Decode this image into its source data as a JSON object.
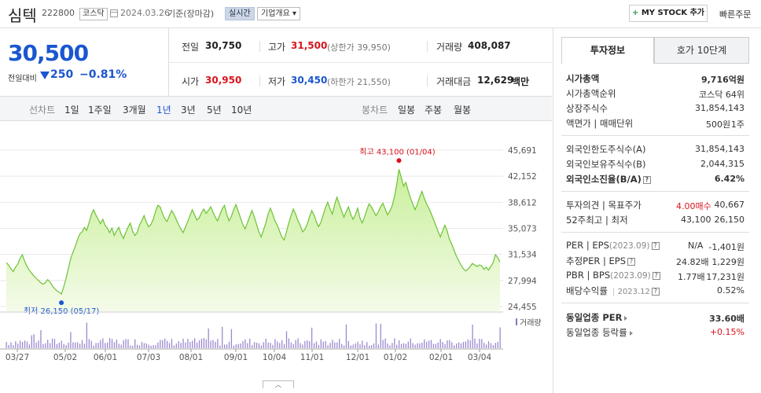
{
  "header": {
    "name": "심텍",
    "code": "222800",
    "market": "코스닥",
    "date": "2024.03.26",
    "basis": "기준(장마감)",
    "realtime": "실시간",
    "company_info": "기업개요",
    "company_info_arrow": "▾",
    "mystock_plus": "+",
    "mystock": "MY STOCK 추가",
    "quick_order": "빠른주문"
  },
  "price": {
    "current": "30,500",
    "diff_label": "전일대비",
    "diff": "250",
    "rate": "−0.81%",
    "prev_label": "전일",
    "prev": "30,750",
    "high_label": "고가",
    "high": "31,500",
    "upper_limit": "(상한가 39,950)",
    "volume_label": "거래량",
    "volume": "408,087",
    "open_label": "시가",
    "open": "30,950",
    "low_label": "저가",
    "low": "30,450",
    "lower_limit": "(하한가 21,550)",
    "amount_label": "거래대금",
    "amount": "12,629",
    "amount_unit": "백만"
  },
  "tabs": {
    "line_chart": "선차트",
    "periods": [
      "1일",
      "1주일",
      "3개월",
      "1년",
      "3년",
      "5년",
      "10년"
    ],
    "active_period": "1년",
    "candle_chart": "봉차트",
    "candle_periods": [
      "일봉",
      "주봉",
      "월봉"
    ]
  },
  "chart_data": {
    "type": "area",
    "y_ticks": [
      "45,691",
      "42,152",
      "38,612",
      "35,073",
      "31,534",
      "27,994",
      "24,455"
    ],
    "ylim": [
      24455,
      45691
    ],
    "x_ticks": [
      "03/27",
      "05/02",
      "06/01",
      "07/03",
      "08/01",
      "09/01",
      "10/04",
      "11/01",
      "12/01",
      "01/02",
      "02/01",
      "03/04"
    ],
    "high_annotation": "최고 43,100 (01/04)",
    "low_annotation": "최저 26,150 (05/17)",
    "high": 43100,
    "low": 26150,
    "volume_label": "거래량",
    "series": [
      {
        "values": [
          30400,
          30100,
          29600,
          29200,
          29800,
          30200,
          31000,
          31500,
          30600,
          29900,
          29400,
          29000,
          28600,
          28300,
          28000,
          27700,
          27500,
          27700,
          28100,
          27800,
          27300,
          26900,
          26600,
          26400,
          26150,
          27100,
          28200,
          29600,
          30900,
          31800,
          32600,
          33500,
          34300,
          34600,
          35200,
          34800,
          35800,
          36900,
          37600,
          36900,
          36300,
          35700,
          36300,
          35500,
          35100,
          34500,
          35100,
          34100,
          34700,
          35200,
          34300,
          33700,
          34500,
          35200,
          35800,
          34700,
          34100,
          34500,
          35500,
          36100,
          36800,
          35900,
          35300,
          35600,
          36300,
          37400,
          38200,
          38000,
          37100,
          36400,
          36000,
          36800,
          37500,
          37000,
          36300,
          35600,
          35000,
          34500,
          35200,
          36000,
          36800,
          37600,
          36900,
          36200,
          36500,
          37200,
          37700,
          37100,
          37500,
          38000,
          37300,
          36600,
          36100,
          36900,
          37700,
          38200,
          37000,
          36100,
          36700,
          37600,
          38300,
          37400,
          36500,
          35600,
          35000,
          35800,
          36700,
          37500,
          36600,
          35600,
          34600,
          33900,
          34800,
          35800,
          37000,
          37800,
          37000,
          36100,
          35500,
          34700,
          33900,
          33500,
          34600,
          35800,
          36800,
          37700,
          37000,
          36100,
          35500,
          34600,
          34900,
          35600,
          36600,
          37500,
          36900,
          36000,
          35300,
          35900,
          36900,
          37900,
          38600,
          37700,
          37000,
          38300,
          39300,
          38400,
          37500,
          36600,
          37300,
          38000,
          37000,
          36300,
          36900,
          37800,
          36500,
          35800,
          36600,
          37600,
          38400,
          38000,
          37400,
          36800,
          37300,
          38000,
          38500,
          37700,
          36900,
          37400,
          38100,
          39300,
          41000,
          43100,
          42000,
          40800,
          41300,
          40200,
          39200,
          38400,
          37600,
          38300,
          39300,
          40100,
          39200,
          38400,
          37800,
          37100,
          36300,
          35500,
          34700,
          33900,
          34700,
          35500,
          34700,
          33600,
          32900,
          32100,
          31300,
          30700,
          30100,
          29600,
          29300,
          29500,
          29900,
          30300,
          30100,
          29900,
          30100,
          30000,
          29500,
          29800,
          29400,
          29900,
          30400,
          31500,
          31100,
          30500
        ]
      }
    ]
  },
  "invest": {
    "tab_active": "투자정보",
    "tab_other": "호가 10단계",
    "market_cap_label": "시가총액",
    "market_cap": "9,716억원",
    "rank_label": "시가총액순위",
    "rank": "코스닥 64위",
    "shares_label": "상장주식수",
    "shares": "31,854,143",
    "par_label": "액면가 | 매매단위",
    "par": "500원",
    "unit": "1주",
    "foreign_limit_label": "외국인한도주식수(A)",
    "foreign_limit": "31,854,143",
    "foreign_hold_label": "외국인보유주식수(B)",
    "foreign_hold": "2,044,315",
    "foreign_ratio_label": "외국인소진율(B/A)",
    "foreign_ratio": "6.42%",
    "opinion_label": "투자의견 | 목표주가",
    "opinion": "4.00매수",
    "target": "40,667",
    "w52_label": "52주최고 | 최저",
    "w52_high": "43,100",
    "w52_low": "26,150",
    "per_label": "PER | EPS",
    "per_year": "(2023.09)",
    "per": "N/A",
    "eps": "-1,401원",
    "est_per_label": "추정PER | EPS",
    "est_per": "24.82배",
    "est_eps": "1,229원",
    "pbr_label": "PBR | BPS",
    "pbr_year": "(2023.09)",
    "pbr": "1.77배",
    "bps": "17,231원",
    "div_label": "배당수익률",
    "div_year": "2023.12",
    "div": "0.52%",
    "sector_per_label": "동일업종 PER",
    "sector_per": "33.60배",
    "sector_rate_label": "동일업종 등락률",
    "sector_rate": "+0.15%"
  }
}
